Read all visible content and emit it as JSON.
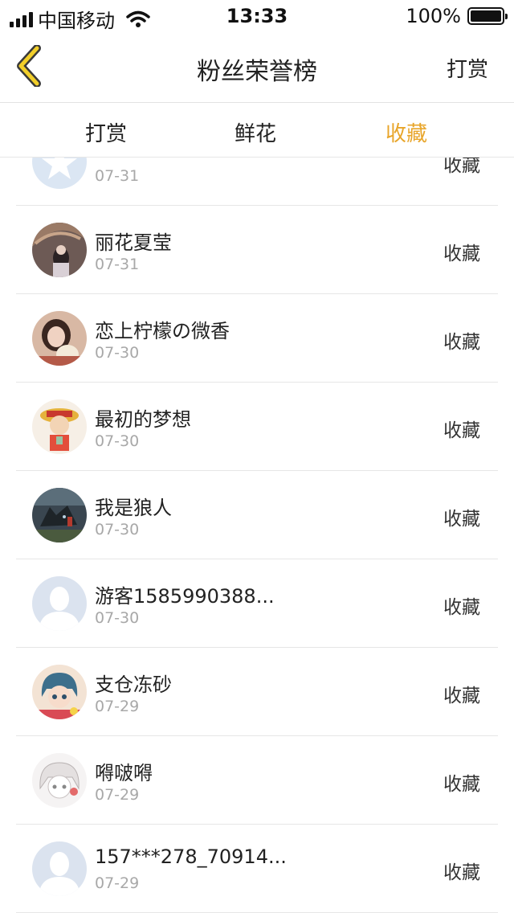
{
  "status_bar": {
    "carrier": "中国移动",
    "time": "13:33",
    "battery": "100%"
  },
  "nav": {
    "title": "粉丝荣誉榜",
    "right_label": "打赏"
  },
  "tabs": [
    {
      "label": "打赏",
      "active": false
    },
    {
      "label": "鲜花",
      "active": false
    },
    {
      "label": "收藏",
      "active": true
    }
  ],
  "colors": {
    "accent": "#e8a52a",
    "back_icon": "#f2cf2a"
  },
  "rows": [
    {
      "name": "",
      "date": "07-31",
      "action": "收藏",
      "avatar": "default-star"
    },
    {
      "name": "丽花夏莹",
      "date": "07-31",
      "action": "收藏",
      "avatar": "photo-umbrella"
    },
    {
      "name": "恋上柠檬の微香",
      "date": "07-30",
      "action": "收藏",
      "avatar": "photo-girl"
    },
    {
      "name": "最初的梦想",
      "date": "07-30",
      "action": "收藏",
      "avatar": "photo-anime-straw-hat"
    },
    {
      "name": "我是狼人",
      "date": "07-30",
      "action": "收藏",
      "avatar": "photo-wolf"
    },
    {
      "name": "游客1585990388...",
      "date": "07-30",
      "action": "收藏",
      "avatar": "default-person"
    },
    {
      "name": "支仓冻砂",
      "date": "07-29",
      "action": "收藏",
      "avatar": "photo-anime-girl"
    },
    {
      "name": "嘚啵嘚",
      "date": "07-29",
      "action": "收藏",
      "avatar": "photo-anime-sketch"
    },
    {
      "name": "157***278_70914...",
      "date": "07-29",
      "action": "收藏",
      "avatar": "default-person"
    }
  ]
}
